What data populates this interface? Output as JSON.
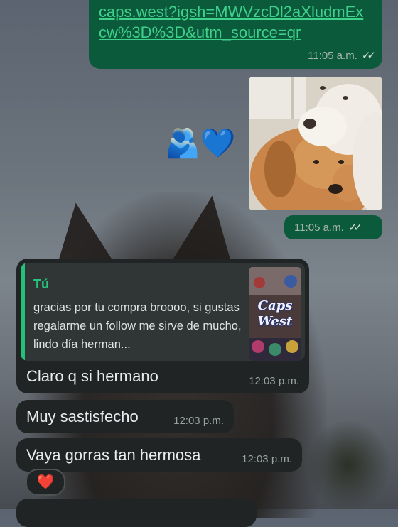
{
  "link_message": {
    "url_text": "caps.west?igsh=MWVzcDl2aXludmExcw%3D%3D&utm_source=qr",
    "time": "11:05 a.m.",
    "status_icon": "double-check-icon"
  },
  "photo_message": {
    "time": "11:05 a.m.",
    "status_icon": "double-check-icon",
    "reactions": "🫂💙"
  },
  "reply_message": {
    "quote_author": "Tú",
    "quote_text": "gracias por tu compra broooo, si gustas regalarme un follow me sirve de mucho, lindo día herman...",
    "quote_thumb_text": "Caps West",
    "text": "Claro q si hermano",
    "time": "12:03 p.m."
  },
  "messages": [
    {
      "text": "Muy sastisfecho",
      "time": "12:03 p.m."
    },
    {
      "text": "Vaya gorras tan hermosa",
      "time": "12:03 p.m.",
      "reaction": "❤️"
    }
  ],
  "colors": {
    "outgoing_bubble": "#0b5a3c",
    "incoming_bubble": "#202424",
    "link": "#3fd08a",
    "quote_accent": "#25c07a"
  }
}
